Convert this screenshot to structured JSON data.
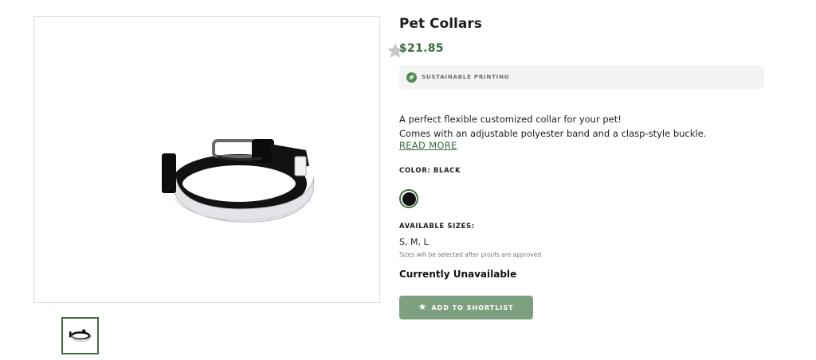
{
  "product": {
    "title": "Pet Collars",
    "price": "$21.85",
    "badge": {
      "icon": "leaf-icon",
      "text": "SUSTAINABLE PRINTING"
    },
    "description_lines": [
      "A perfect flexible customized collar for your pet!",
      "Comes with an adjustable polyester band and a clasp-style buckle."
    ],
    "read_more": "READ MORE",
    "color_label": "COLOR: BLACK",
    "colors": [
      {
        "name": "Black",
        "hex": "#111111",
        "selected": true
      }
    ],
    "sizes_label": "AVAILABLE SIZES:",
    "sizes_value": "S, M, L",
    "sizes_note": "Sizes will be selected after proofs are approved",
    "availability": "Currently Unavailable",
    "shortlist_button": {
      "icon": "star-icon",
      "label": "ADD TO SHORTLIST"
    }
  },
  "gallery": {
    "favorite_icon": "star-icon",
    "thumbnails": [
      {
        "name": "collar-thumbnail",
        "selected": true
      }
    ]
  },
  "theme": {
    "accent": "#356b3a",
    "button_bg": "#7e9f80",
    "badge_bg": "#f4f4f4",
    "border": "#dcdcdc"
  }
}
